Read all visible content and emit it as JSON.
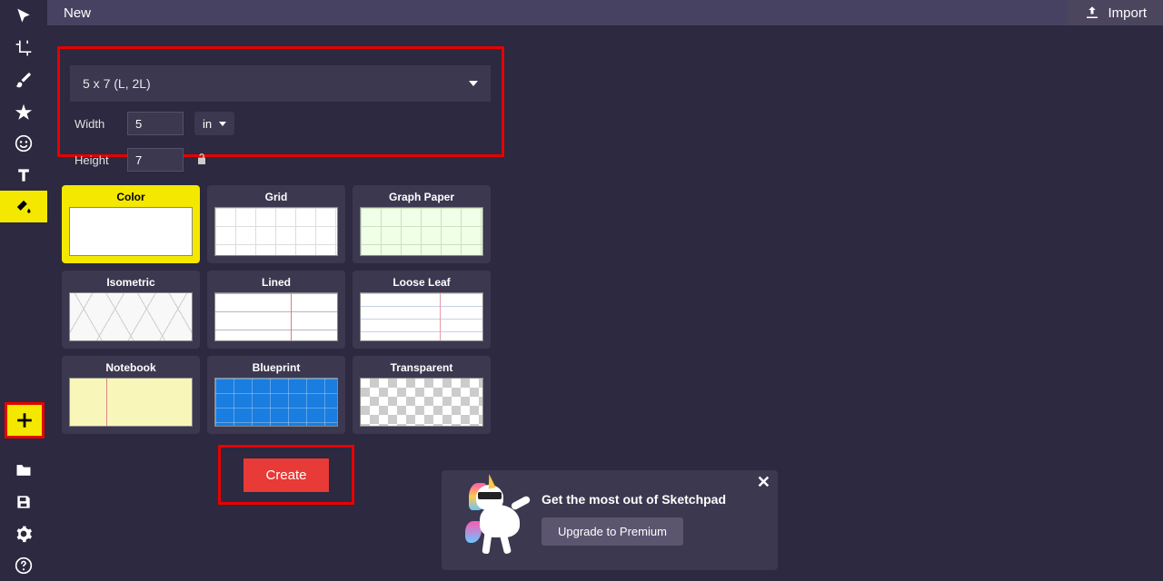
{
  "header": {
    "tab_label": "New",
    "import_label": "Import"
  },
  "preset": {
    "label": "5 x 7 (L, 2L)"
  },
  "dimensions": {
    "width_label": "Width",
    "width_value": "5",
    "height_label": "Height",
    "height_value": "7",
    "unit": "in"
  },
  "cards": {
    "color": "Color",
    "grid": "Grid",
    "graph_paper": "Graph Paper",
    "isometric": "Isometric",
    "lined": "Lined",
    "loose_leaf": "Loose Leaf",
    "notebook": "Notebook",
    "blueprint": "Blueprint",
    "transparent": "Transparent"
  },
  "buttons": {
    "create": "Create",
    "upgrade": "Upgrade to Premium"
  },
  "popup": {
    "title": "Get the most out of Sketchpad"
  },
  "toolbar": {
    "pointer": "pointer",
    "crop": "crop",
    "brush": "brush",
    "star": "star",
    "face": "face",
    "text": "text",
    "fill": "fill",
    "plus": "plus",
    "folder": "folder",
    "save": "save",
    "settings": "settings",
    "help": "help"
  }
}
